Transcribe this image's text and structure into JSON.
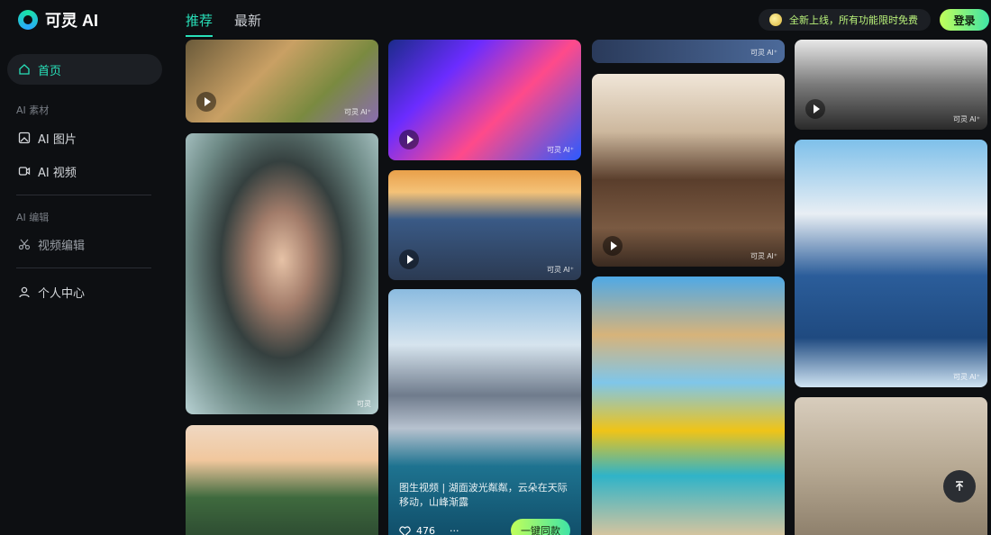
{
  "app": {
    "logo_text": "可灵 AI",
    "tabs": [
      "推荐",
      "最新"
    ],
    "promo_text": "全新上线，所有功能限时免费",
    "login_label": "登录"
  },
  "sidebar": {
    "home": "首页",
    "section_material": "AI 素材",
    "ai_image": "AI 图片",
    "ai_video": "AI 视频",
    "section_edit": "AI 编辑",
    "video_edit": "视频编辑",
    "personal_center": "个人中心"
  },
  "feed": {
    "watermark": "可灵",
    "watermark_plus": "可灵 AI⁺",
    "lake_card": {
      "description": "图生视频 | 湖面波光粼粼，云朵在天际移动，山峰渐露",
      "likes": "476",
      "more": "···",
      "same_button": "一键同款"
    }
  },
  "colors": {
    "accent": "#28e0b9",
    "login_gradient_start": "#c2ff5a",
    "login_gradient_end": "#3fe4a6",
    "background": "#0d0f12"
  }
}
